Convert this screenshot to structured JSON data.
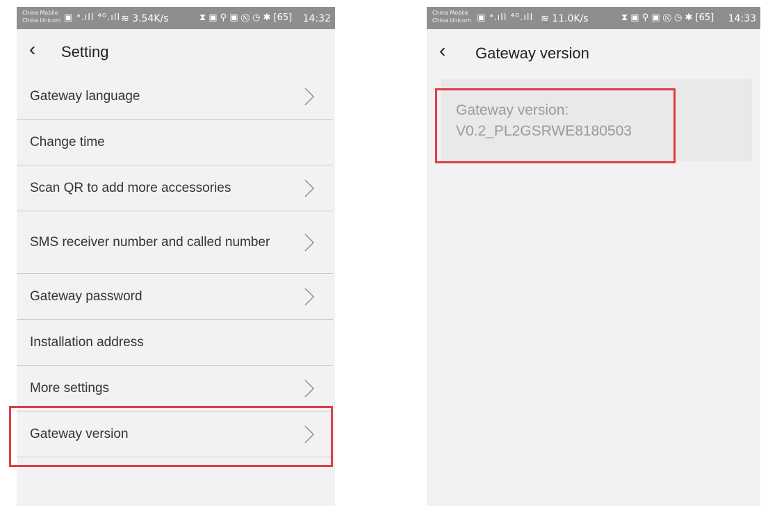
{
  "left_screen": {
    "status_bar": {
      "carrier_line1": "China Mobile",
      "carrier_line2": "China Unicom",
      "icons": "▣ ᵃ.ıll ⁴ᴳ.ıll",
      "speed": "≋ 3.54K/s",
      "right_icons": "⧗ ▣ ⚲ ▣   Ⓝ ◷ ✱ [65]",
      "time": "14:32"
    },
    "app_bar": {
      "back_icon": "‹",
      "title": "Setting"
    },
    "menu_items": [
      {
        "label": "Gateway language",
        "chevron": true
      },
      {
        "label": "Change time",
        "chevron": false
      },
      {
        "label": "Scan QR to add more accessories",
        "chevron": true
      },
      {
        "label": "SMS receiver number and called number",
        "chevron": true
      },
      {
        "label": "Gateway password",
        "chevron": true
      },
      {
        "label": "Installation address",
        "chevron": false
      },
      {
        "label": "More settings",
        "chevron": true
      },
      {
        "label": "Gateway version",
        "chevron": true
      }
    ]
  },
  "right_screen": {
    "status_bar": {
      "carrier_line1": "China Mobile",
      "carrier_line2": "China Unicom",
      "icons": "▣ ᵃ.ıll ⁴ᴳ.ıll",
      "speed": "≋ 11.0K/s",
      "right_icons": "⧗ ▣ ⚲ ▣   Ⓝ ◷ ✱ [65]",
      "time": "14:33"
    },
    "app_bar": {
      "back_icon": "‹",
      "title": "Gateway version"
    },
    "info": {
      "line1": "Gateway version:",
      "line2": "V0.2_PL2GSRWE8180503"
    }
  },
  "colors": {
    "highlight": "#e13c44",
    "status_bar": "#8e8e8e",
    "background": "#f2f2f2"
  }
}
